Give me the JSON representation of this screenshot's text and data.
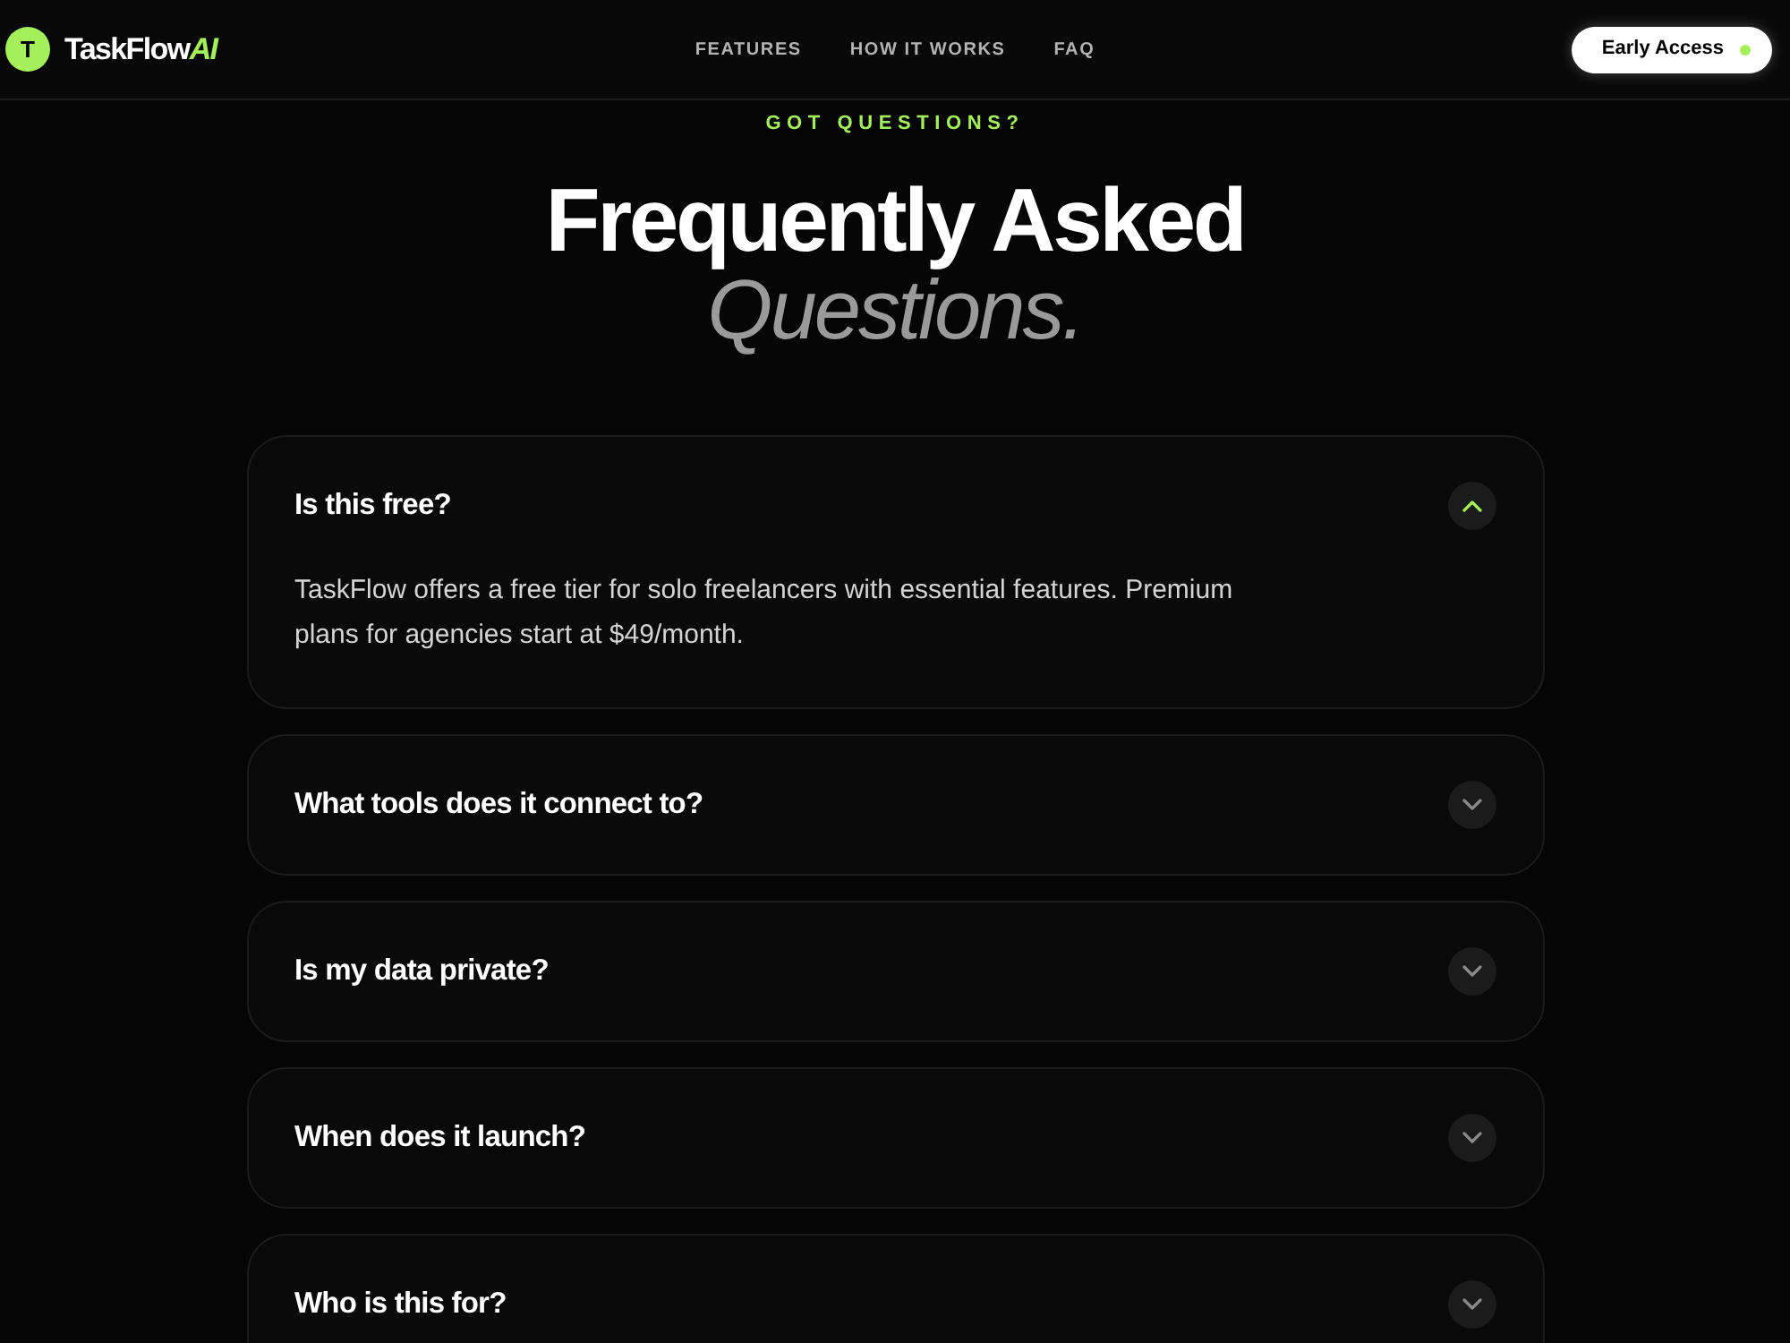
{
  "navbar": {
    "logo_letter": "T",
    "brand": "TaskFlow",
    "brand_suffix": "AI",
    "links": [
      "FEATURES",
      "HOW IT WORKS",
      "FAQ"
    ],
    "cta": "Early Access"
  },
  "section": {
    "eyebrow": "GOT QUESTIONS?",
    "title": "Frequently Asked",
    "title_accent": "Questions."
  },
  "faq": [
    {
      "question": "Is this free?",
      "expanded": true,
      "answer": "TaskFlow offers a free tier for solo freelancers with essential features. Premium plans for agencies start at $49/month."
    },
    {
      "question": "What tools does it connect to?",
      "expanded": false
    },
    {
      "question": "Is my data private?",
      "expanded": false
    },
    {
      "question": "When does it launch?",
      "expanded": false
    },
    {
      "question": "Who is this for?",
      "expanded": false
    }
  ]
}
